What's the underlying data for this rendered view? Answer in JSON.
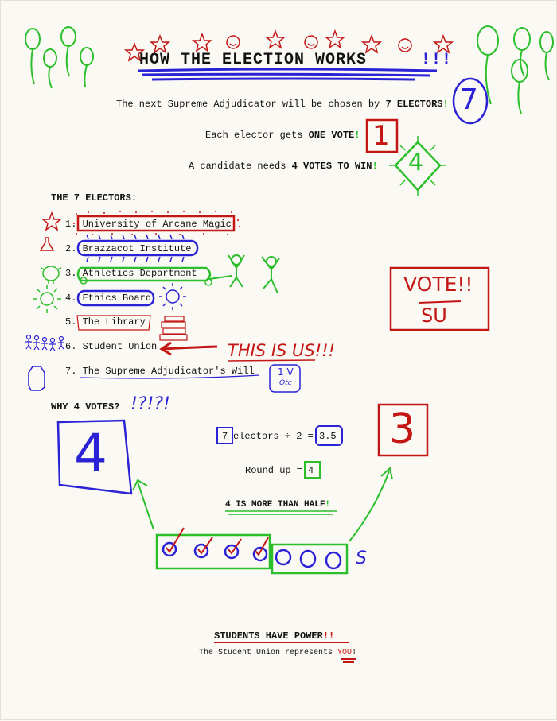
{
  "title": "HOW THE ELECTION WORKS",
  "title_exclaim": "!!!",
  "intro": {
    "line1_pre": "The next Supreme Adjudicator will be chosen by",
    "line1_strong": "7 ELECTORS",
    "line2_pre": "Each elector gets",
    "line2_strong": "ONE VOTE",
    "line3_pre": "A candidate needs",
    "line3_strong": "4 VOTES TO WIN",
    "bang": "!"
  },
  "electors_heading": "THE 7 ELECTORS:",
  "electors": [
    {
      "num": "1.",
      "name": "University of Arcane Magic"
    },
    {
      "num": "2.",
      "name": "Brazzacot Institute"
    },
    {
      "num": "3.",
      "name": "Athletics Department"
    },
    {
      "num": "4.",
      "name": "Ethics Board"
    },
    {
      "num": "5.",
      "name": "The Library"
    },
    {
      "num": "6.",
      "name": "Student Union"
    },
    {
      "num": "7.",
      "name": "The Supreme Adjudicator's Will"
    }
  ],
  "doodle_text": {
    "box7": "7",
    "box1": "1",
    "diamond4": "4",
    "vote_sign_top": "VOTE!!",
    "vote_sign_bottom": "SU",
    "this_is_us": "THIS IS US!!!",
    "one_v": "1 V",
    "one_v_sub": "Otc",
    "big4": "4",
    "big3": "3",
    "question_marks": "!?!?!",
    "s_mark": "S"
  },
  "why": {
    "heading": "WHY 4 VOTES?",
    "math_7": "7",
    "math_mid": "electors ÷ 2 =",
    "math_result": "3.5",
    "round_label": "Round up =",
    "round_value": "4",
    "more_than_half": "4 IS MORE THAN HALF",
    "bang": "!"
  },
  "footer": {
    "headline": "STUDENTS HAVE POWER",
    "headline_exclaim": "!!",
    "sub_pre": "The Student Union represents",
    "sub_you": "YOU",
    "sub_bang": "!"
  }
}
